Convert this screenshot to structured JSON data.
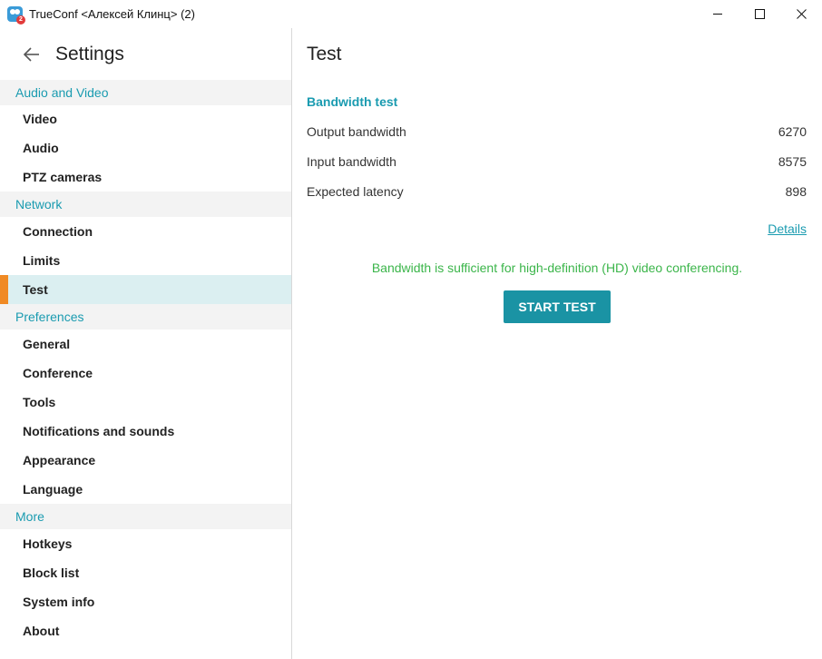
{
  "window": {
    "title": "TrueConf <Алексей Клинц> (2)",
    "badge": "2"
  },
  "sidebar": {
    "title": "Settings",
    "sections": [
      {
        "label": "Audio and Video",
        "items": [
          "Video",
          "Audio",
          "PTZ cameras"
        ]
      },
      {
        "label": "Network",
        "items": [
          "Connection",
          "Limits",
          "Test"
        ]
      },
      {
        "label": "Preferences",
        "items": [
          "General",
          "Conference",
          "Tools",
          "Notifications and sounds",
          "Appearance",
          "Language"
        ]
      },
      {
        "label": "More",
        "items": [
          "Hotkeys",
          "Block list",
          "System info",
          "About"
        ]
      }
    ],
    "active_item": "Test"
  },
  "content": {
    "title": "Test",
    "section_heading": "Bandwidth test",
    "rows": [
      {
        "label": "Output bandwidth",
        "value": "6270"
      },
      {
        "label": "Input bandwidth",
        "value": "8575"
      },
      {
        "label": "Expected latency",
        "value": "898"
      }
    ],
    "details_link": "Details",
    "status_message": "Bandwidth is sufficient for high-definition (HD) video conferencing.",
    "start_button": "START TEST"
  },
  "colors": {
    "accent": "#1a9bb0",
    "button": "#1a93a4",
    "active_marker": "#f08a24",
    "active_bg": "#dbeff1",
    "success": "#3bb54a"
  }
}
